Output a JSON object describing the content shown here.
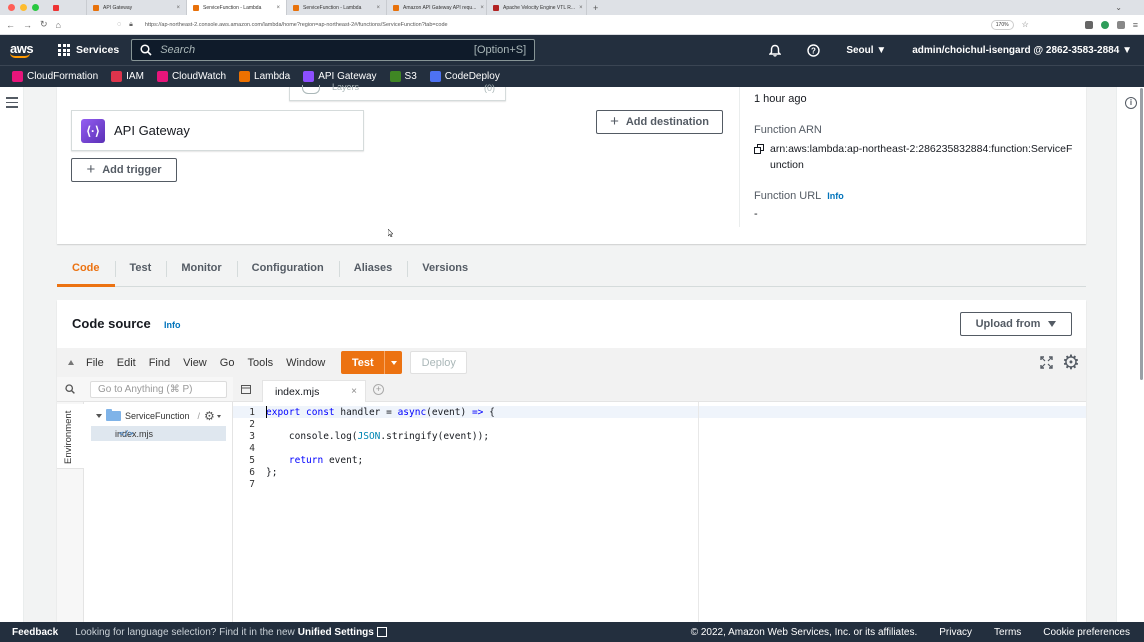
{
  "browser": {
    "tabs": [
      {
        "title": "API Gateway",
        "fav_color": "#e8710a",
        "active": false
      },
      {
        "title": "ServiceFunction - Lambda",
        "fav_color": "#e8710a",
        "active": true
      },
      {
        "title": "ServiceFunction - Lambda",
        "fav_color": "#e8710a",
        "active": false
      },
      {
        "title": "Amazon API Gateway API requ...",
        "fav_color": "#e8710a",
        "active": false
      },
      {
        "title": "Apache Velocity Engine VTL R...",
        "fav_color": "#b22222",
        "active": false
      }
    ],
    "url": "https://ap-northeast-2.console.aws.amazon.com/lambda/home?region=ap-northeast-2#/functions/ServiceFunction?tab=code",
    "zoom": "170%"
  },
  "topnav": {
    "logo": "aws",
    "services": "Services",
    "search_placeholder": "Search",
    "search_shortcut": "[Option+S]",
    "region": "Seoul",
    "account": "admin/choichul-isengard @ 2862-3583-2884"
  },
  "favorites": [
    {
      "label": "CloudFormation",
      "color": "#e7157b"
    },
    {
      "label": "IAM",
      "color": "#dd344c"
    },
    {
      "label": "CloudWatch",
      "color": "#e7157b"
    },
    {
      "label": "Lambda",
      "color": "#ed7100"
    },
    {
      "label": "API Gateway",
      "color": "#8c4fff"
    },
    {
      "label": "S3",
      "color": "#3f8624"
    },
    {
      "label": "CodeDeploy",
      "color": "#4d72f3"
    }
  ],
  "overview": {
    "layers_label": "Layers",
    "layers_count": "(0)",
    "trigger_name": "API Gateway",
    "add_trigger": "Add trigger",
    "add_destination": "Add destination",
    "last_modified": "1 hour ago",
    "arn_label": "Function ARN",
    "arn_value": "arn:aws:lambda:ap-northeast-2:286235832884:function:ServiceFunction",
    "url_label": "Function URL",
    "info": "Info",
    "url_value": "-"
  },
  "tabs": [
    "Code",
    "Test",
    "Monitor",
    "Configuration",
    "Aliases",
    "Versions"
  ],
  "code_source": {
    "title": "Code source",
    "info": "Info",
    "upload_from": "Upload from",
    "menu": [
      "File",
      "Edit",
      "Find",
      "View",
      "Go",
      "Tools",
      "Window"
    ],
    "test": "Test",
    "deploy": "Deploy",
    "go_anything": "Go to Anything (⌘ P)",
    "environment": "Environment",
    "folder": "ServiceFunction",
    "folder_suffix": "/",
    "file": "index.mjs",
    "open_tab": "index.mjs",
    "lines": [
      "1",
      "2",
      "3",
      "4",
      "5",
      "6",
      "7"
    ]
  },
  "footer": {
    "feedback": "Feedback",
    "lang_question": "Looking for language selection? Find it in the new",
    "lang_link": "Unified Settings",
    "copyright": "© 2022, Amazon Web Services, Inc. or its affiliates.",
    "privacy": "Privacy",
    "terms": "Terms",
    "cookies": "Cookie preferences"
  },
  "colors": {
    "nav_bg": "#232f3e",
    "accent": "#ec7211",
    "link": "#0073bb"
  }
}
